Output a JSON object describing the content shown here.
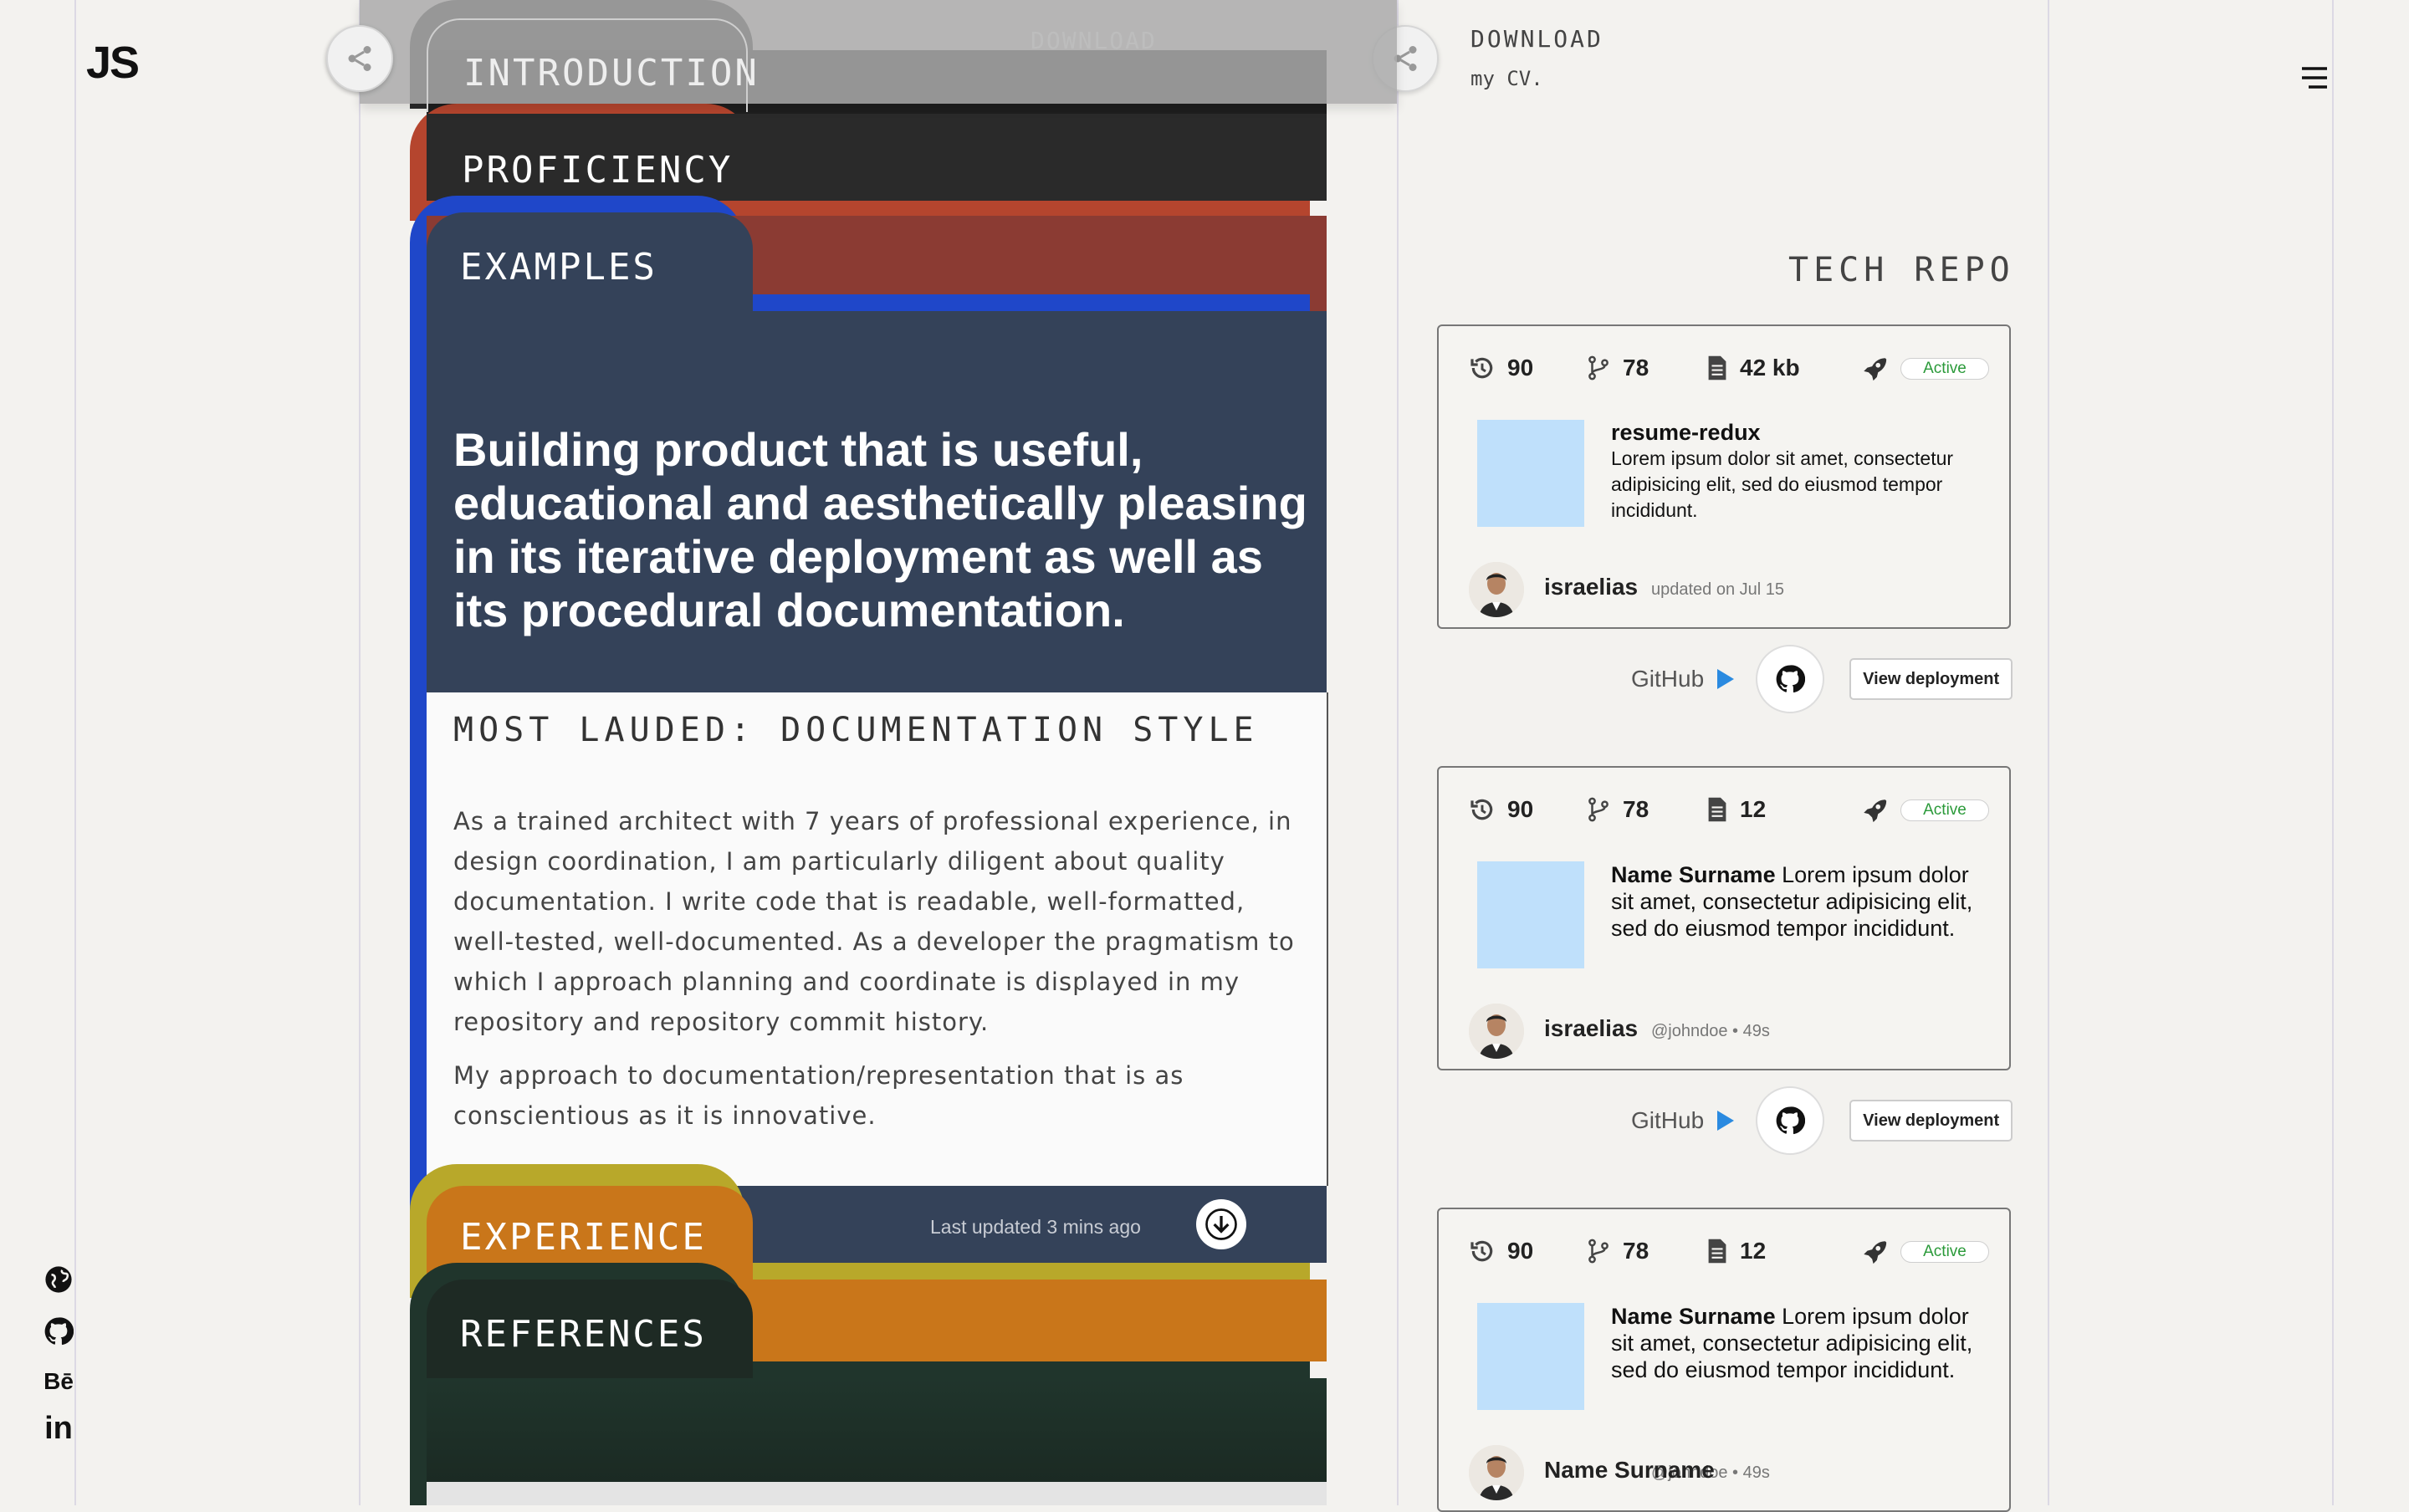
{
  "brand": {
    "logo": "JS"
  },
  "social": [
    "globe-icon",
    "github-icon",
    "behance-icon",
    "linkedin-icon"
  ],
  "social_labels": {
    "behance": "Bē",
    "linkedin": "in"
  },
  "download": {
    "ghost_label": "DOWNLOAD",
    "title": "DOWNLOAD",
    "subtitle": "my CV."
  },
  "tabs": {
    "introduction": "INTRODUCTION",
    "proficiency": "PROFICIENCY",
    "examples": "EXAMPLES",
    "experience": "EXPERIENCE",
    "references": "REFERENCES"
  },
  "examples": {
    "headline": "Building product that is useful, educational and aesthetically pleasing in its iterative deployment as well as its procedural documentation.",
    "lauded": "MOST LAUDED: DOCUMENTATION STYLE",
    "paragraph1": "As a trained architect with 7 years of professional experience, in design coordination, I am particularly diligent about quality documentation. I write code that is readable, well-formatted, well-tested, well-documented. As a developer the pragmatism to which I approach planning and coordinate is displayed in my repository and repository commit history.",
    "paragraph2": "My approach to documentation/representation that is as conscientious as it is innovative.",
    "last_updated": "Last updated 3 mins ago"
  },
  "tech_repo": {
    "title": "TECH REPO",
    "repos": [
      {
        "commits": "90",
        "branches": "78",
        "size": "42 kb",
        "status": "Active",
        "name": "resume-redux",
        "description": "Lorem ipsum dolor sit amet, consectetur adipisicing elit, sed do eiusmod tempor incididunt.",
        "user": "israelias",
        "meta": "updated on Jul 15",
        "github_label": "GitHub",
        "deploy_label": "View deployment"
      },
      {
        "commits": "90",
        "branches": "78",
        "size": "12",
        "status": "Active",
        "name": "Name Surname",
        "description": "Lorem ipsum dolor sit amet, consectetur adipisicing elit, sed do eiusmod tempor incididunt.",
        "user": "israelias",
        "meta": "@johndoe • 49s",
        "github_label": "GitHub",
        "deploy_label": "View deployment"
      },
      {
        "commits": "90",
        "branches": "78",
        "size": "12",
        "status": "Active",
        "name": "Name Surname",
        "description": "Lorem ipsum dolor sit amet, consectetur adipisicing elit, sed do eiusmod tempor incididunt.",
        "user": "Name Surname",
        "meta": "@johndoe • 49s"
      }
    ]
  },
  "colors": {
    "introduction": "#1e1e1e",
    "proficiency": "#b5452e",
    "examples_border": "#1f47c9",
    "examples_body": "#344259",
    "experience": "#c9761a",
    "experience_border": "#b8a82a",
    "references": "#20352c"
  }
}
